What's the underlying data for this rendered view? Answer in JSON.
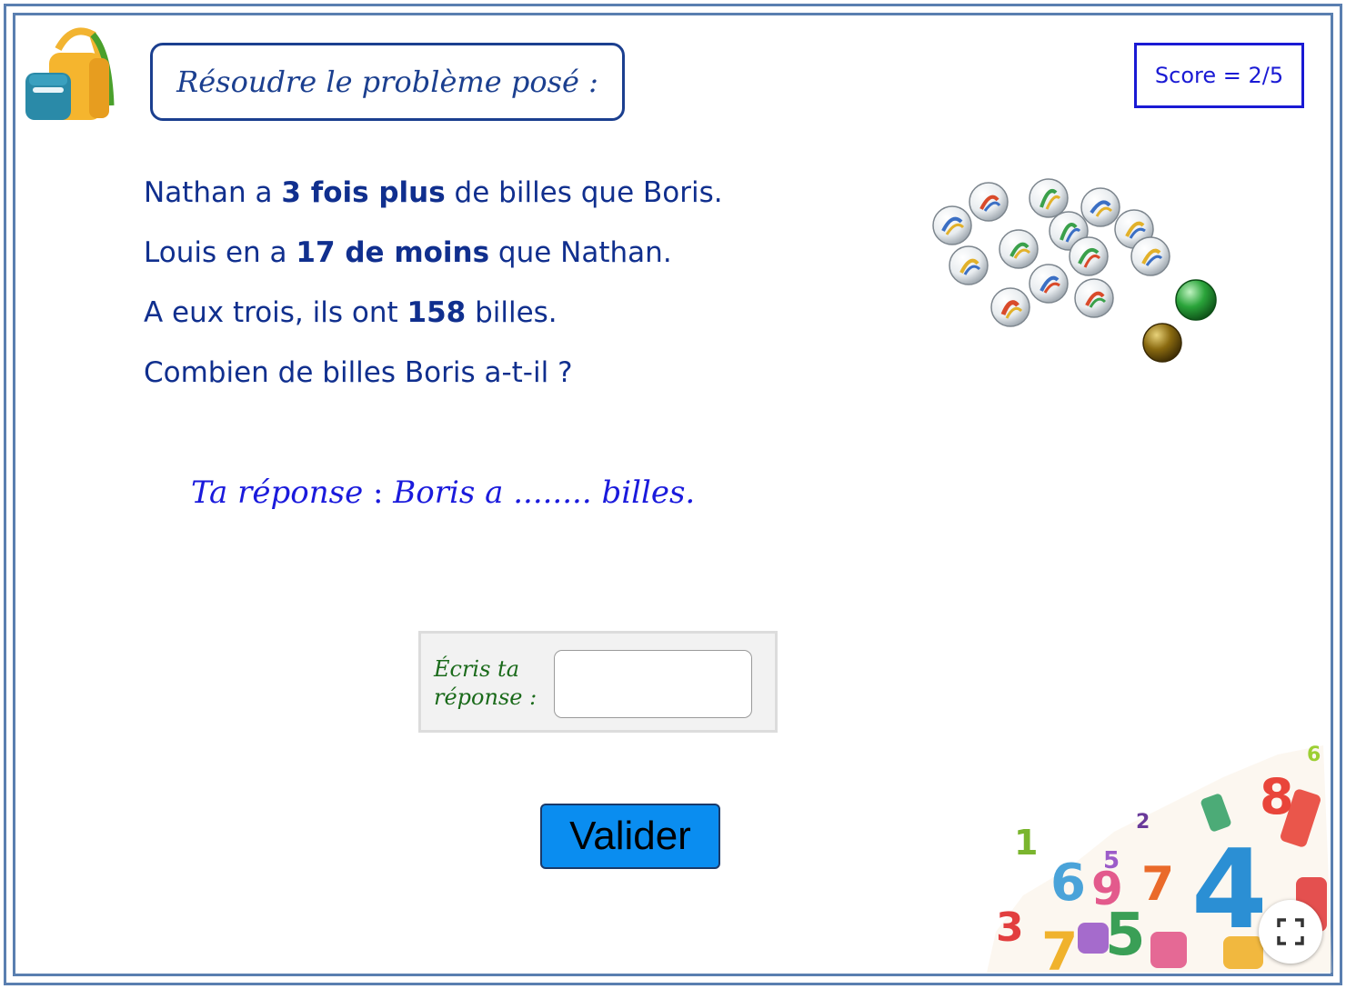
{
  "header": {
    "title": "Résoudre le problème posé :",
    "score": "Score = 2/5"
  },
  "problem": {
    "line1": {
      "pre": "Nathan a ",
      "bold": "3 fois plus",
      "post": " de billes que Boris."
    },
    "line2": {
      "pre": "Louis en a ",
      "bold": "17 de moins",
      "post": " que Nathan."
    },
    "line3": {
      "pre": "A eux trois,  ils ont ",
      "bold": "158",
      "post": " billes."
    },
    "line4": "Combien de billes Boris a-t-il ?"
  },
  "answer_line": {
    "label": "Ta réponse",
    "colon": " : ",
    "sentence": "Boris a ........ billes."
  },
  "input": {
    "label_line1": "Écris ta",
    "label_line2": "réponse :",
    "value": ""
  },
  "buttons": {
    "validate": "Valider"
  },
  "decor_numbers": [
    "6",
    "2",
    "5",
    "8",
    "1",
    "4",
    "6",
    "9",
    "7",
    "3",
    "5",
    "7"
  ],
  "colors": {
    "frame": "#5a7fb0",
    "text": "#102f8e",
    "score": "#1a1ad4",
    "answer": "#1a1adc",
    "input_label": "#1a6a1a",
    "button": "#0a8df0"
  }
}
